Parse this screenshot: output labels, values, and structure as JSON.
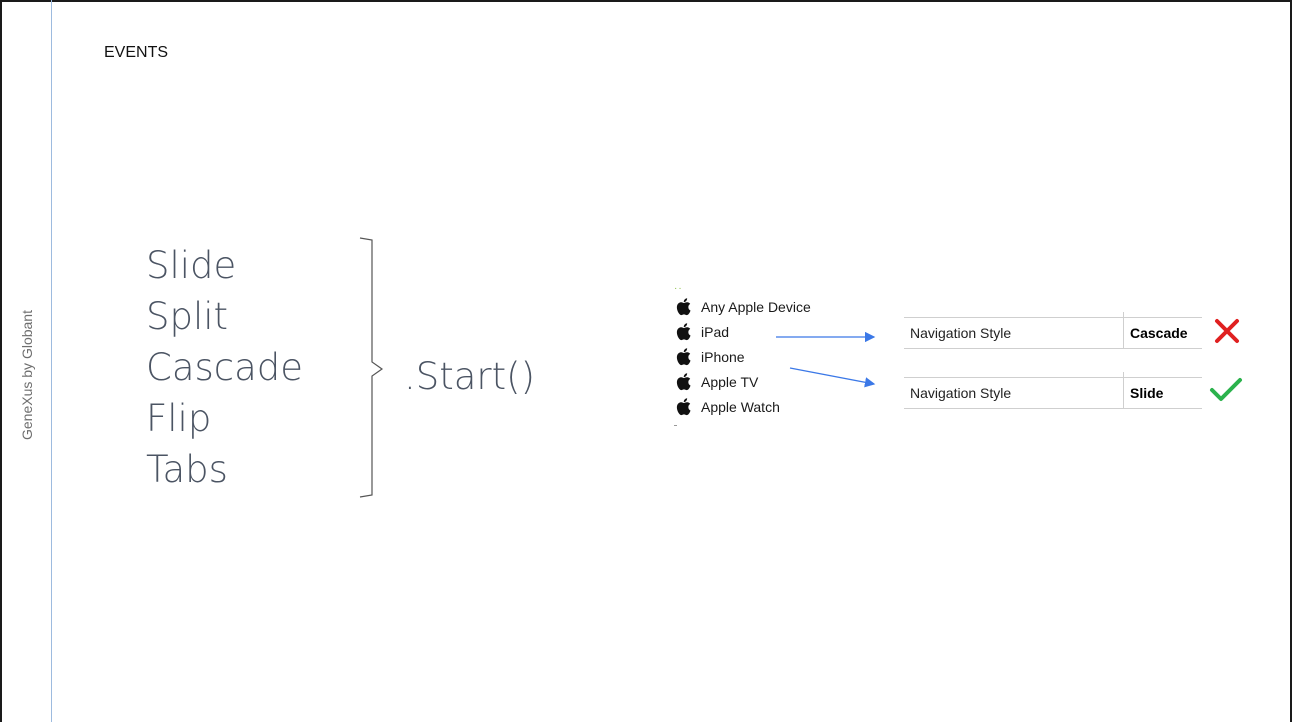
{
  "slide": {
    "title": "EVENTS",
    "side_label": "GeneXus by Globant",
    "navigation_styles": [
      "Slide",
      "Split",
      "Cascade",
      "Flip",
      "Tabs"
    ],
    "method": ".Start()"
  },
  "devices": [
    {
      "label": "Any Apple Device",
      "icon": "apple-icon"
    },
    {
      "label": "iPad",
      "icon": "apple-icon"
    },
    {
      "label": "iPhone",
      "icon": "apple-icon"
    },
    {
      "label": "Apple TV",
      "icon": "apple-icon"
    },
    {
      "label": "Apple Watch",
      "icon": "apple-icon"
    }
  ],
  "properties": [
    {
      "name": "Navigation Style",
      "value": "Cascade",
      "mark": "cross-icon",
      "mark_color": "#e02020"
    },
    {
      "name": "Navigation Style",
      "value": "Slide",
      "mark": "check-icon",
      "mark_color": "#2bb24c"
    }
  ],
  "colors": {
    "arrow": "#3b78e7",
    "text_light": "#4b5463",
    "side_line": "#9dbbdf",
    "device_dots": "#8cc04a"
  }
}
